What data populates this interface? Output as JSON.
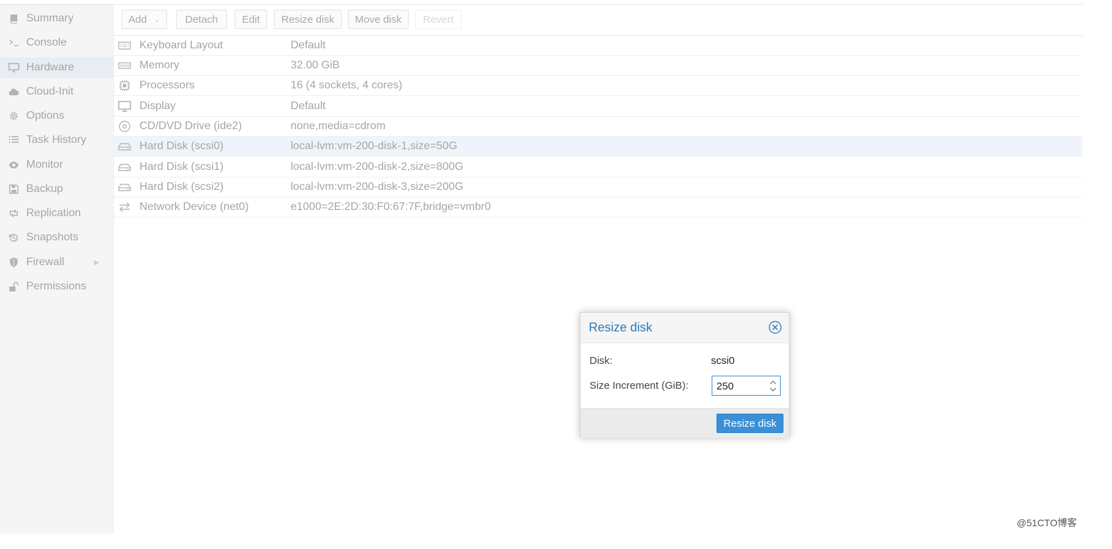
{
  "sidebar": {
    "items": [
      {
        "label": "Summary",
        "icon": "book-icon"
      },
      {
        "label": "Console",
        "icon": "terminal-icon"
      },
      {
        "label": "Hardware",
        "icon": "monitor-icon",
        "active": true
      },
      {
        "label": "Cloud-Init",
        "icon": "cloud-icon"
      },
      {
        "label": "Options",
        "icon": "gear-icon"
      },
      {
        "label": "Task History",
        "icon": "list-icon"
      },
      {
        "label": "Monitor",
        "icon": "eye-icon"
      },
      {
        "label": "Backup",
        "icon": "floppy-icon"
      },
      {
        "label": "Replication",
        "icon": "retweet-icon"
      },
      {
        "label": "Snapshots",
        "icon": "history-icon"
      },
      {
        "label": "Firewall",
        "icon": "shield-icon",
        "expander_icon": "chevron-right-icon"
      },
      {
        "label": "Permissions",
        "icon": "unlock-icon"
      }
    ]
  },
  "toolbar": {
    "add_label": "Add",
    "add_caret_icon": "chevron-down-icon",
    "detach_label": "Detach",
    "edit_label": "Edit",
    "resize_label": "Resize disk",
    "move_label": "Move disk",
    "revert_label": "Revert"
  },
  "hardware": {
    "rows": [
      {
        "name": "Keyboard Layout",
        "value": "Default",
        "icon": "keyboard-icon"
      },
      {
        "name": "Memory",
        "value": "32.00 GiB",
        "icon": "memory-icon"
      },
      {
        "name": "Processors",
        "value": "16 (4 sockets, 4 cores)",
        "icon": "cpu-icon"
      },
      {
        "name": "Display",
        "value": "Default",
        "icon": "display-icon"
      },
      {
        "name": "CD/DVD Drive (ide2)",
        "value": "none,media=cdrom",
        "icon": "cdrom-icon"
      },
      {
        "name": "Hard Disk (scsi0)",
        "value": "local-lvm:vm-200-disk-1,size=50G",
        "icon": "hdd-icon",
        "selected": true
      },
      {
        "name": "Hard Disk (scsi1)",
        "value": "local-lvm:vm-200-disk-2,size=800G",
        "icon": "hdd-icon"
      },
      {
        "name": "Hard Disk (scsi2)",
        "value": "local-lvm:vm-200-disk-3,size=200G",
        "icon": "hdd-icon"
      },
      {
        "name": "Network Device (net0)",
        "value": "e1000=2E:2D:30:F0:67:7F,bridge=vmbr0",
        "icon": "exchange-icon"
      }
    ]
  },
  "dialog": {
    "title": "Resize disk",
    "close_icon": "close-circle-icon",
    "disk_label": "Disk:",
    "disk_value": "scsi0",
    "size_label": "Size Increment (GiB):",
    "size_value": "250",
    "spinner_icon": "spinner-updown-icon",
    "submit_label": "Resize disk"
  },
  "watermark": "@51CTO博客",
  "colors": {
    "accent": "#3990d8",
    "title_blue": "#2e7ab8",
    "selected_row": "#eef4fa",
    "muted_text": "#a5a5a5"
  }
}
